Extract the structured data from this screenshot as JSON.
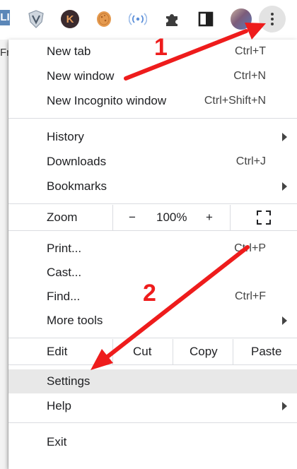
{
  "toolbar": {
    "left_chip": "LI",
    "k_badge": "K",
    "icons": [
      "shield-v-icon",
      "k-extension-icon",
      "cookie-extension-icon",
      "broadcast-icon",
      "puzzle-extensions-icon",
      "side-panel-icon",
      "profile-avatar",
      "kebab-menu-icon"
    ]
  },
  "page_peek": "Fr",
  "menu": {
    "group1": [
      {
        "label": "New tab",
        "shortcut": "Ctrl+T"
      },
      {
        "label": "New window",
        "shortcut": "Ctrl+N"
      },
      {
        "label": "New Incognito window",
        "shortcut": "Ctrl+Shift+N"
      }
    ],
    "group2": [
      {
        "label": "History",
        "shortcut": ""
      },
      {
        "label": "Downloads",
        "shortcut": "Ctrl+J"
      },
      {
        "label": "Bookmarks",
        "shortcut": ""
      }
    ],
    "zoom": {
      "label": "Zoom",
      "minus": "−",
      "value": "100%",
      "plus": "+"
    },
    "group3": [
      {
        "label": "Print...",
        "shortcut": "Ctrl+P"
      },
      {
        "label": "Cast...",
        "shortcut": ""
      },
      {
        "label": "Find...",
        "shortcut": "Ctrl+F"
      },
      {
        "label": "More tools",
        "shortcut": ""
      }
    ],
    "edit": {
      "label": "Edit",
      "cut": "Cut",
      "copy": "Copy",
      "paste": "Paste"
    },
    "settings": {
      "label": "Settings"
    },
    "help": {
      "label": "Help"
    },
    "exit": {
      "label": "Exit"
    }
  },
  "annotations": {
    "step1": "1",
    "step2": "2",
    "arrow_color": "#ee1c1c"
  }
}
